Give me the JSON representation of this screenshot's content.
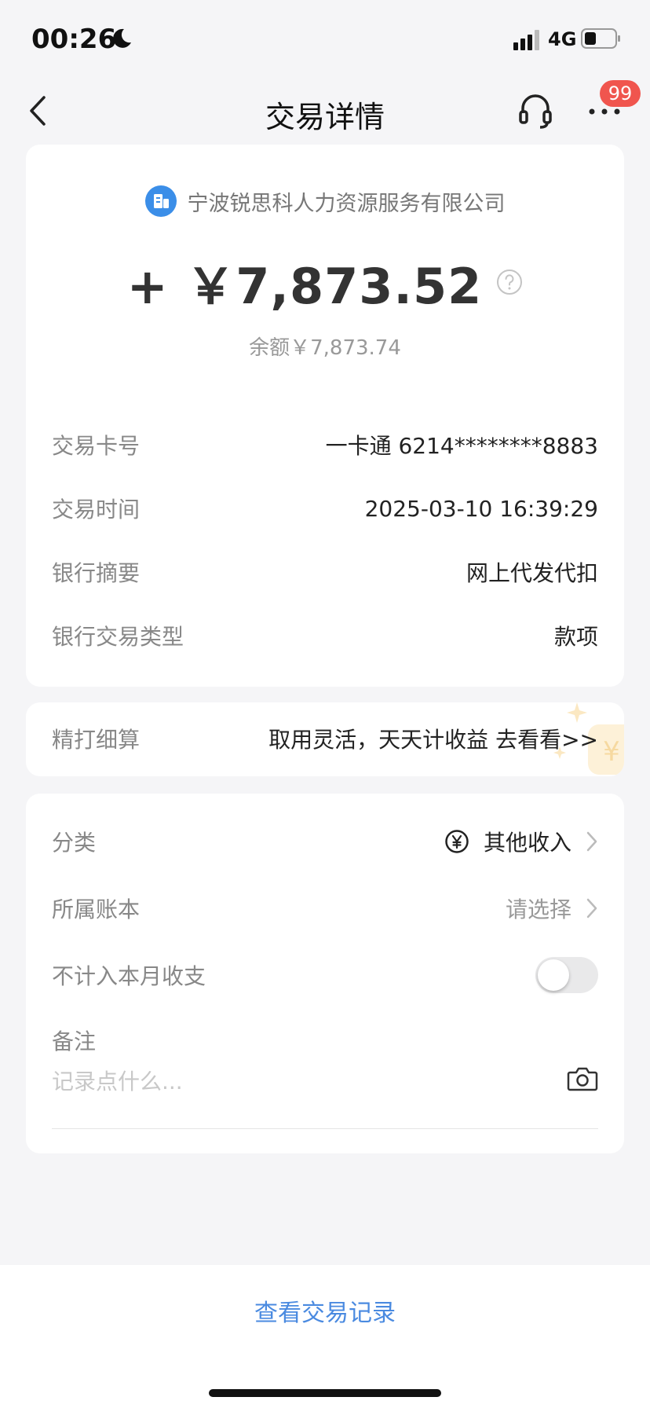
{
  "status_bar": {
    "time": "00:26",
    "network": "4G"
  },
  "nav": {
    "title": "交易详情",
    "badge": "99"
  },
  "transaction": {
    "merchant": "宁波锐思科人力资源服务有限公司",
    "amount": "+ ￥7,873.52",
    "balance": "余额￥7,873.74"
  },
  "details": [
    {
      "label": "交易卡号",
      "value": "一卡通 6214********8883"
    },
    {
      "label": "交易时间",
      "value": "2025-03-10 16:39:29"
    },
    {
      "label": "银行摘要",
      "value": "网上代发代扣"
    },
    {
      "label": "银行交易类型",
      "value": "款项"
    }
  ],
  "promo": {
    "label": "精打细算",
    "text": "取用灵活，天天计收益 去看看>>"
  },
  "category": {
    "label": "分类",
    "value": "其他收入"
  },
  "ledger": {
    "label": "所属账本",
    "value": "请选择"
  },
  "exclude": {
    "label": "不计入本月收支",
    "enabled": false
  },
  "note": {
    "label": "备注",
    "placeholder": "记录点什么..."
  },
  "bottom": {
    "link": "查看交易记录"
  },
  "colors": {
    "accent": "#4a8ae0",
    "badge": "#f0554e",
    "merchant_icon": "#3b8ee8"
  }
}
